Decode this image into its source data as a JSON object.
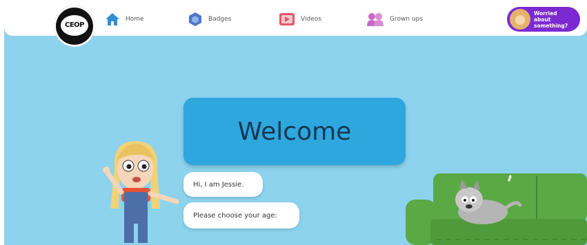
{
  "nav": {
    "logo_text": "CEOP",
    "items": [
      {
        "label": "Home",
        "icon": "house-icon"
      },
      {
        "label": "Badges",
        "icon": "badge-icon"
      },
      {
        "label": "Videos",
        "icon": "video-icon"
      },
      {
        "label": "Grown ups",
        "icon": "people-icon"
      }
    ],
    "worried_button": "Worried about something?"
  },
  "main": {
    "title": "Welcome",
    "bubbles": [
      "Hi, I am Jessie.",
      "Please choose your age:"
    ]
  },
  "colors": {
    "background": "#8dd3ee",
    "welcome_card": "#2ea7df",
    "worried_button": "#7b2ad1",
    "sofa": "#5aa944"
  }
}
